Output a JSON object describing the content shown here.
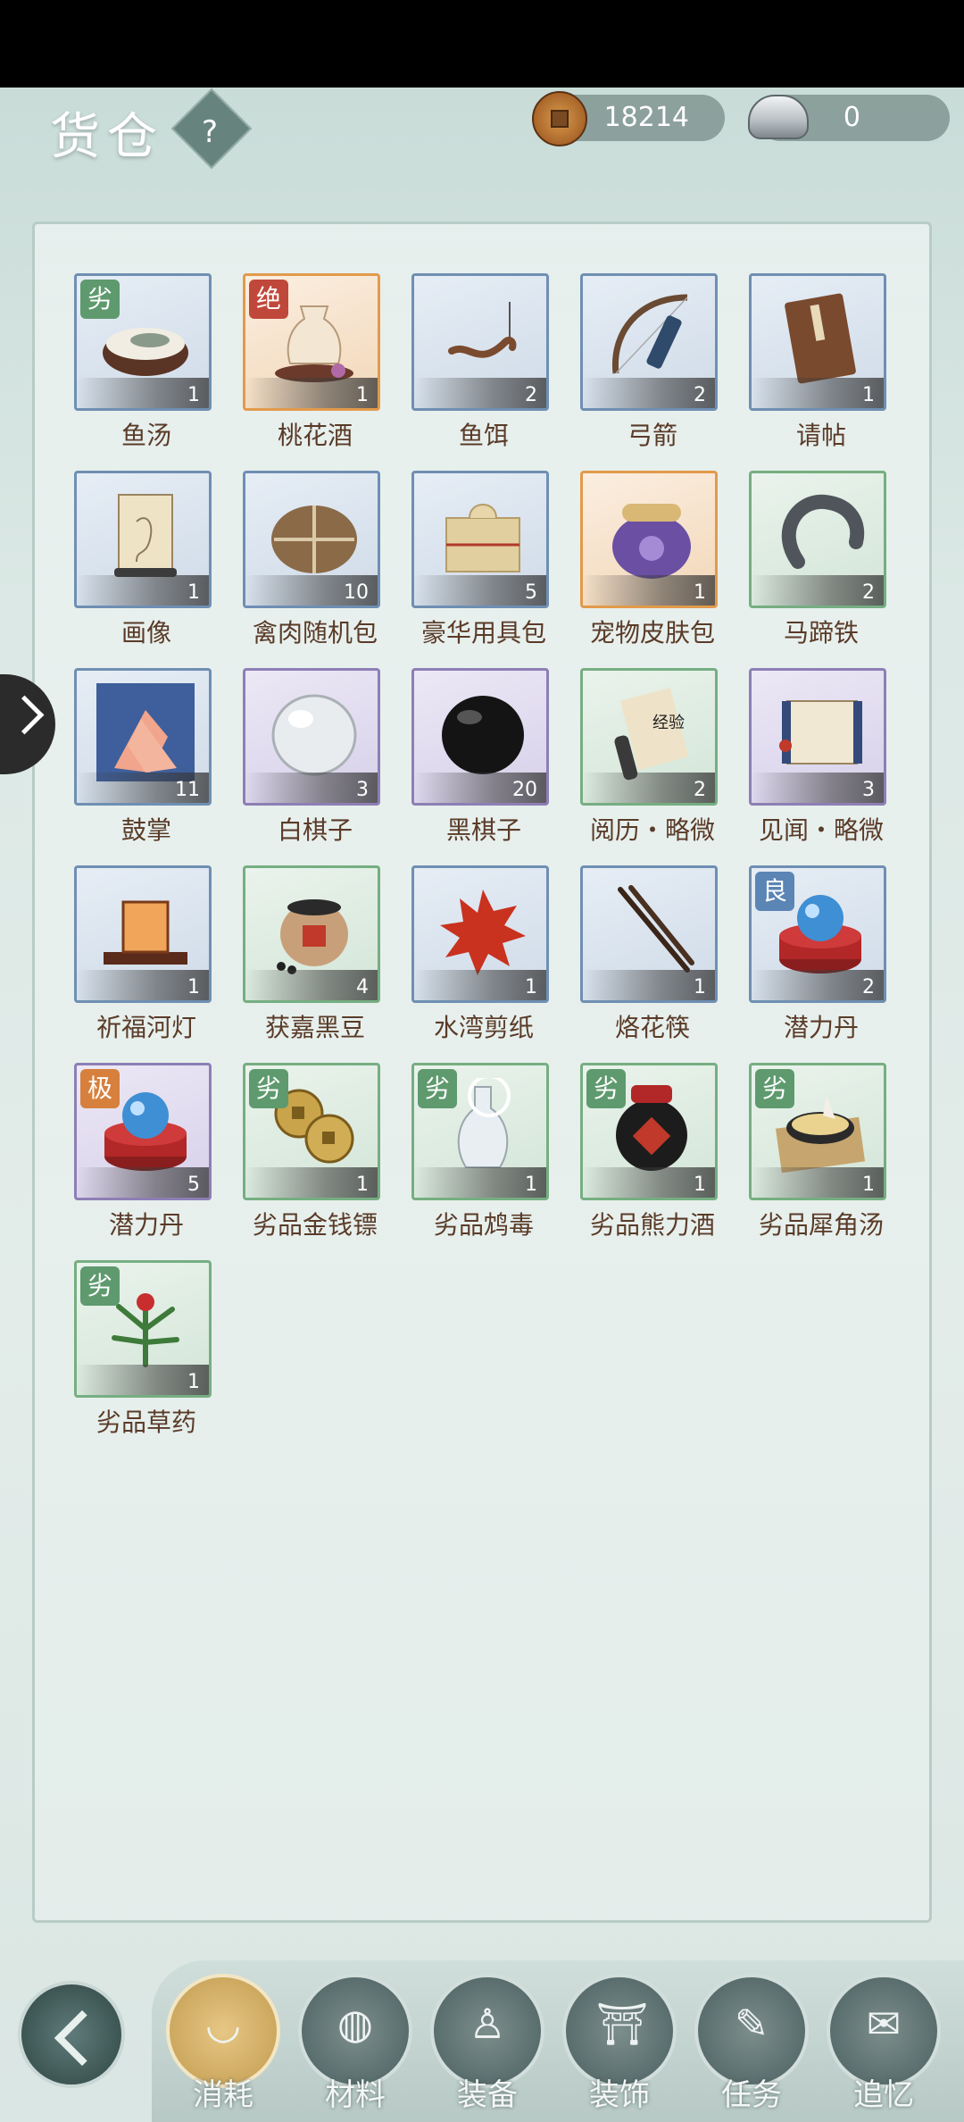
{
  "header": {
    "title": "货仓",
    "help_label": "?",
    "coins": "18214",
    "silver": "0"
  },
  "items": [
    {
      "name": "鱼汤",
      "count": "1",
      "badge": "劣",
      "frame": "blue",
      "icon": "fish-soup-icon"
    },
    {
      "name": "桃花酒",
      "count": "1",
      "badge": "绝",
      "frame": "orange",
      "icon": "peach-wine-icon"
    },
    {
      "name": "鱼饵",
      "count": "2",
      "badge": "",
      "frame": "blue",
      "icon": "fish-bait-icon"
    },
    {
      "name": "弓箭",
      "count": "2",
      "badge": "",
      "frame": "blue",
      "icon": "bow-arrow-icon"
    },
    {
      "name": "请帖",
      "count": "1",
      "badge": "",
      "frame": "blue",
      "icon": "invitation-book-icon"
    },
    {
      "name": "画像",
      "count": "1",
      "badge": "",
      "frame": "blue",
      "icon": "portrait-scroll-icon"
    },
    {
      "name": "禽肉随机包",
      "count": "10",
      "badge": "",
      "frame": "blue",
      "icon": "meat-bundle-icon"
    },
    {
      "name": "豪华用具包",
      "count": "5",
      "badge": "",
      "frame": "blue",
      "icon": "gift-package-icon"
    },
    {
      "name": "宠物皮肤包",
      "count": "1",
      "badge": "",
      "frame": "orange",
      "icon": "pet-skin-bag-icon"
    },
    {
      "name": "马蹄铁",
      "count": "2",
      "badge": "",
      "frame": "green",
      "icon": "horseshoe-icon"
    },
    {
      "name": "鼓掌",
      "count": "11",
      "badge": "",
      "frame": "blue",
      "icon": "clapping-hands-icon"
    },
    {
      "name": "白棋子",
      "count": "3",
      "badge": "",
      "frame": "purple",
      "icon": "white-go-stone-icon"
    },
    {
      "name": "黑棋子",
      "count": "20",
      "badge": "",
      "frame": "purple",
      "icon": "black-go-stone-icon"
    },
    {
      "name": "阅历・略微",
      "count": "2",
      "badge": "",
      "frame": "green",
      "icon": "experience-scroll-icon"
    },
    {
      "name": "见闻・略微",
      "count": "3",
      "badge": "",
      "frame": "purple",
      "icon": "knowledge-scroll-icon"
    },
    {
      "name": "祈福河灯",
      "count": "1",
      "badge": "",
      "frame": "blue",
      "icon": "river-lantern-icon"
    },
    {
      "name": "获嘉黑豆",
      "count": "4",
      "badge": "",
      "frame": "green",
      "icon": "black-beans-jar-icon"
    },
    {
      "name": "水湾剪纸",
      "count": "1",
      "badge": "",
      "frame": "blue",
      "icon": "paper-cutting-icon"
    },
    {
      "name": "烙花筷",
      "count": "1",
      "badge": "",
      "frame": "blue",
      "icon": "chopsticks-icon"
    },
    {
      "name": "潜力丹",
      "count": "2",
      "badge": "良",
      "frame": "blue",
      "icon": "potential-pill-icon"
    },
    {
      "name": "潜力丹",
      "count": "5",
      "badge": "极",
      "frame": "purple",
      "icon": "potential-pill-icon"
    },
    {
      "name": "劣品金钱镖",
      "count": "1",
      "badge": "劣",
      "frame": "green",
      "icon": "coin-dart-icon"
    },
    {
      "name": "劣品鸩毒",
      "count": "1",
      "badge": "劣",
      "frame": "green",
      "icon": "poison-bottle-icon"
    },
    {
      "name": "劣品熊力酒",
      "count": "1",
      "badge": "劣",
      "frame": "green",
      "icon": "bear-wine-jar-icon"
    },
    {
      "name": "劣品犀角汤",
      "count": "1",
      "badge": "劣",
      "frame": "green",
      "icon": "rhino-horn-soup-icon"
    },
    {
      "name": "劣品草药",
      "count": "1",
      "badge": "劣",
      "frame": "green",
      "icon": "herb-icon"
    }
  ],
  "nav": {
    "tabs": [
      {
        "label": "消耗",
        "icon": "bowl-icon",
        "active": true
      },
      {
        "label": "材料",
        "icon": "materials-icon",
        "active": false
      },
      {
        "label": "装备",
        "icon": "robe-icon",
        "active": false
      },
      {
        "label": "装饰",
        "icon": "gate-icon",
        "active": false
      },
      {
        "label": "任务",
        "icon": "task-book-icon",
        "active": false
      },
      {
        "label": "追忆",
        "icon": "letter-icon",
        "active": false
      }
    ]
  },
  "colors": {
    "label": "#5a3b28",
    "frame_blue": "#6f8fb3",
    "frame_green": "#76ae82",
    "frame_orange": "#e29a4b",
    "frame_purple": "#8d7fb5",
    "active_tab": "#c9a45a"
  }
}
